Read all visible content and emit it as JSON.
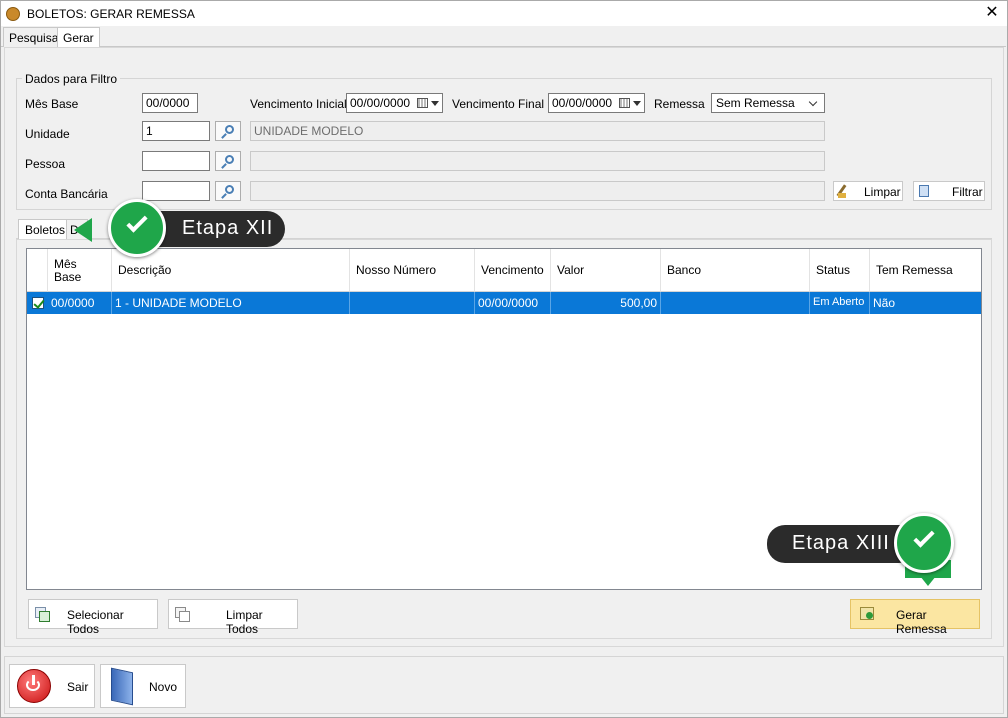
{
  "window": {
    "title": "BOLETOS: GERAR REMESSA",
    "close_glyph": "✕"
  },
  "tabs": [
    {
      "label": "Pesquisa"
    },
    {
      "label": "Gerar"
    }
  ],
  "filter": {
    "legend": "Dados para Filtro",
    "mes_base_label": "Mês Base",
    "mes_base_value": "00/0000",
    "venc_ini_label": "Vencimento Inicial",
    "venc_ini_value": "00/00/0000",
    "venc_fin_label": "Vencimento Final",
    "venc_fin_value": "00/00/0000",
    "remessa_label": "Remessa",
    "remessa_value": "Sem Remessa",
    "unidade_label": "Unidade",
    "unidade_code": "1",
    "unidade_name": "UNIDADE MODELO",
    "pessoa_label": "Pessoa",
    "pessoa_code": "",
    "pessoa_name": "",
    "conta_label": "Conta Bancária",
    "conta_code": "",
    "conta_name": "",
    "limpar_label": "Limpar",
    "filtrar_label": "Filtrar"
  },
  "inner_tabs": [
    {
      "label": "Boletos"
    },
    {
      "label": "D"
    }
  ],
  "grid": {
    "columns": [
      "Mês Base",
      "Descrição",
      "Nosso Número",
      "Vencimento",
      "Valor",
      "Banco",
      "Status",
      "Tem Remessa"
    ],
    "rows": [
      {
        "checked": true,
        "mes_base": "00/0000",
        "descricao": "1 - UNIDADE MODELO",
        "nosso_numero": "",
        "vencimento": "00/00/0000",
        "valor": "500,00",
        "banco": "",
        "status": "Em Aberto",
        "tem_remessa": "Não"
      }
    ]
  },
  "actions": {
    "selecionar_todos": "Selecionar Todos",
    "limpar_todos": "Limpar Todos",
    "gerar_remessa": "Gerar Remessa"
  },
  "footer": {
    "sair": "Sair",
    "novo": "Novo"
  },
  "callouts": {
    "step12": "Etapa XII",
    "step13": "Etapa XIII"
  },
  "colors": {
    "selection": "#0a78d7",
    "callout_bg": "#2b2b2b",
    "badge_green": "#1fa64a",
    "gerar_bg": "#fbe6a2"
  }
}
